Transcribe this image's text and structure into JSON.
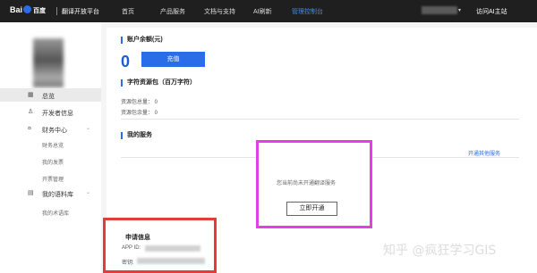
{
  "topbar": {
    "logo_left": "Bai",
    "logo_right": "百度",
    "platform": "翻译开放平台",
    "nav": [
      "首页",
      "产品服务",
      "文档与支持",
      "AI刷新",
      "管理控制台"
    ],
    "active_nav": "管理控制台",
    "visit": "访问AI主站"
  },
  "sidebar": {
    "items": [
      {
        "label": "总览",
        "icon": "grid-icon"
      },
      {
        "label": "开发者信息",
        "icon": "user-icon"
      },
      {
        "label": "财务中心",
        "icon": "finance-icon"
      },
      {
        "label": "我的语料库",
        "icon": "corpus-icon"
      }
    ],
    "finance_sub": [
      "财务总览",
      "我的发票",
      "开票管理"
    ],
    "corpus_sub": [
      "我的术语库"
    ]
  },
  "account": {
    "title": "账户余额(元)",
    "balance": "0",
    "recharge_label": "充值"
  },
  "char_pack": {
    "title": "字符资源包（百万字符）",
    "total": "资源包总量： 0",
    "remain": "资源包余量： 0"
  },
  "services": {
    "title": "我的服务",
    "open_more": "开通其他服务",
    "not_open": "您当前尚未开通翻译服务",
    "open_now": "立即开通"
  },
  "application": {
    "title": "申请信息",
    "app_id_label": "APP ID:",
    "secret_label": "密钥:"
  },
  "watermark": "知乎 @疯狂学习GIS",
  "colors": {
    "accent": "#2b6de8",
    "highlight_magenta": "#e23fe6",
    "highlight_red": "#e63b3b"
  }
}
